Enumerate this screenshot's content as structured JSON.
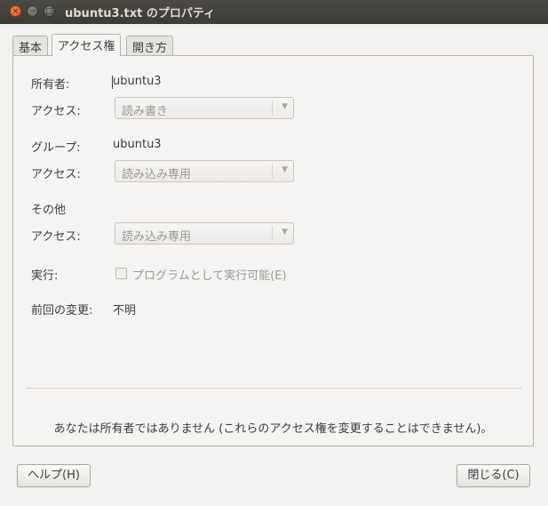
{
  "window": {
    "title": "ubuntu3.txt のプロパティ",
    "close_glyph": "×",
    "minimize_glyph": "−",
    "maximize_glyph": "□"
  },
  "tabs": [
    {
      "label": "基本",
      "active": false
    },
    {
      "label": "アクセス権",
      "active": true
    },
    {
      "label": "開き方",
      "active": false
    }
  ],
  "permissions": {
    "owner_label": "所有者:",
    "owner_value": "ubuntu3",
    "owner_access_label": "アクセス:",
    "owner_access_value": "読み書き",
    "group_label": "グループ:",
    "group_value": "ubuntu3",
    "group_access_label": "アクセス:",
    "group_access_value": "読み込み専用",
    "others_label": "その他",
    "others_access_label": "アクセス:",
    "others_access_value": "読み込み専用",
    "execute_label": "実行:",
    "execute_checkbox_label": "プログラムとして実行可能(E)",
    "execute_checked": false,
    "last_changed_label": "前回の変更:",
    "last_changed_value": "不明",
    "notice": "あなたは所有者ではありません (これらのアクセス権を変更することはできません)。"
  },
  "buttons": {
    "help": "ヘルプ(H)",
    "close": "閉じる(C)"
  },
  "dropdown_arrow_glyph": "▼"
}
